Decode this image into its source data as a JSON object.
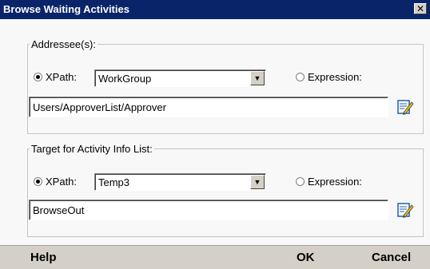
{
  "window": {
    "title": "Browse Waiting Activities",
    "close_glyph": "✕"
  },
  "addressees": {
    "legend": "Addressee(s):",
    "xpath_label": "XPath:",
    "xpath_selected": true,
    "xpath_value": "WorkGroup",
    "expression_label": "Expression:",
    "expression_selected": false,
    "text_value": "Users/ApproverList/Approver",
    "edit_icon": "edit-pencil-icon"
  },
  "target": {
    "legend": "Target for Activity Info List:",
    "xpath_label": "XPath:",
    "xpath_selected": true,
    "xpath_value": "Temp3",
    "expression_label": "Expression:",
    "expression_selected": false,
    "text_value": "BrowseOut",
    "edit_icon": "edit-pencil-icon"
  },
  "footer": {
    "help_label": "Help",
    "ok_label": "OK",
    "cancel_label": "Cancel"
  },
  "colors": {
    "titlebar": "#0a246a",
    "face": "#d4d0c8",
    "client": "#f8f8f8"
  }
}
